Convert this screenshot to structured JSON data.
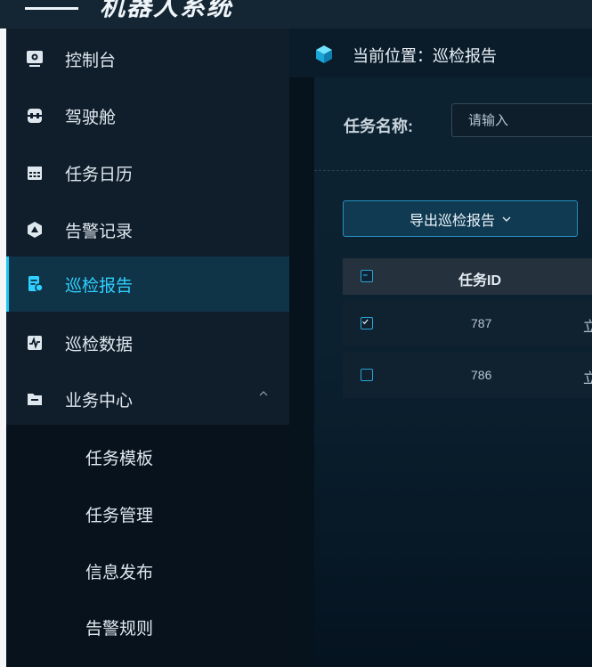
{
  "header": {
    "logo_text": "机器人系统"
  },
  "sidebar": {
    "items": [
      {
        "label": "控制台",
        "icon": "monitor-icon"
      },
      {
        "label": "驾驶舱",
        "icon": "cockpit-icon"
      },
      {
        "label": "任务日历",
        "icon": "calendar-icon"
      },
      {
        "label": "告警记录",
        "icon": "alarm-icon"
      },
      {
        "label": "巡检报告",
        "icon": "report-icon",
        "active": true
      },
      {
        "label": "巡检数据",
        "icon": "data-icon"
      },
      {
        "label": "业务中心",
        "icon": "folder-icon",
        "expanded": true
      }
    ],
    "subitems": [
      {
        "label": "任务模板"
      },
      {
        "label": "任务管理"
      },
      {
        "label": "信息发布"
      },
      {
        "label": "告警规则"
      }
    ]
  },
  "breadcrumb": {
    "text": "当前位置：巡检报告",
    "icon": "cube-icon"
  },
  "search": {
    "label": "任务名称:",
    "placeholder": "请输入"
  },
  "toolbar": {
    "export_label": "导出巡检报告"
  },
  "table": {
    "columns": [
      "任务ID"
    ],
    "rows": [
      {
        "id": "787",
        "checked": true,
        "next_col_clip": "立"
      },
      {
        "id": "786",
        "checked": false,
        "next_col_clip": "立"
      }
    ]
  },
  "colors": {
    "accent": "#1ec5f0",
    "sidebar_bg": "#101e2b",
    "active_bg": "#0f3347"
  }
}
